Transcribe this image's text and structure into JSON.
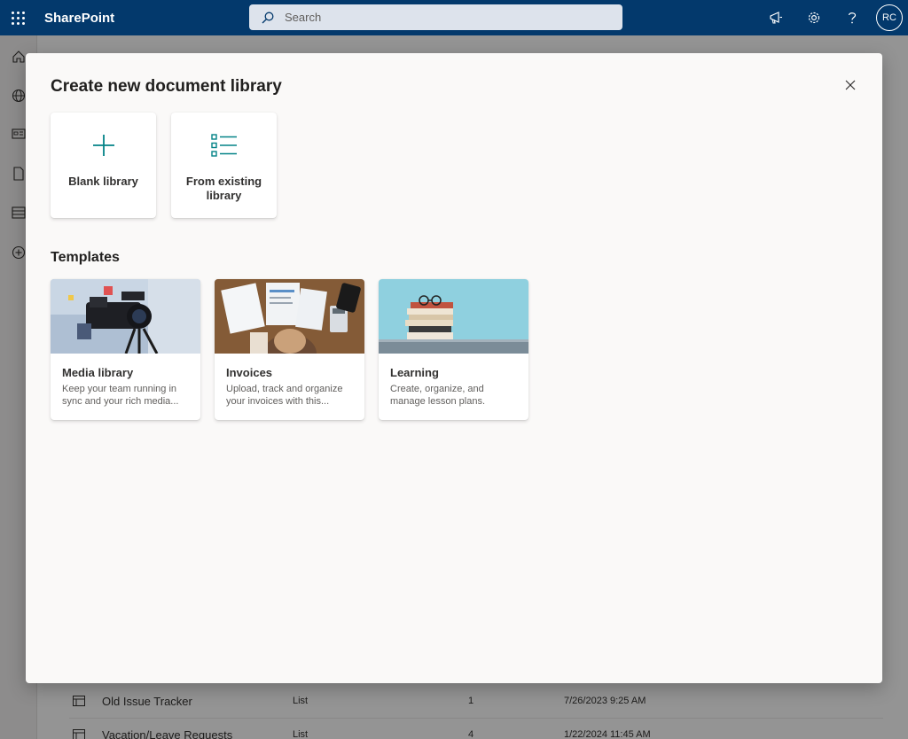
{
  "header": {
    "app_name": "SharePoint",
    "search_placeholder": "Search",
    "avatar_initials": "RC"
  },
  "background_list": {
    "rows": [
      {
        "name": "Old Issue Tracker",
        "type": "List",
        "count": "1",
        "modified": "7/26/2023 9:25 AM"
      },
      {
        "name": "Vacation/Leave Requests",
        "type": "List",
        "count": "4",
        "modified": "1/22/2024 11:45 AM"
      }
    ]
  },
  "dialog": {
    "title": "Create new document library",
    "options": [
      {
        "label": "Blank library",
        "icon": "plus-icon"
      },
      {
        "label": "From existing library",
        "icon": "list-icon"
      }
    ],
    "templates_heading": "Templates",
    "templates": [
      {
        "name": "Media library",
        "description": "Keep your team running in sync and your rich media..."
      },
      {
        "name": "Invoices",
        "description": "Upload, track and organize your invoices with this..."
      },
      {
        "name": "Learning",
        "description": "Create, organize, and manage lesson plans."
      }
    ]
  },
  "colors": {
    "suite_bar": "#03396c",
    "accent_teal": "#038387"
  }
}
